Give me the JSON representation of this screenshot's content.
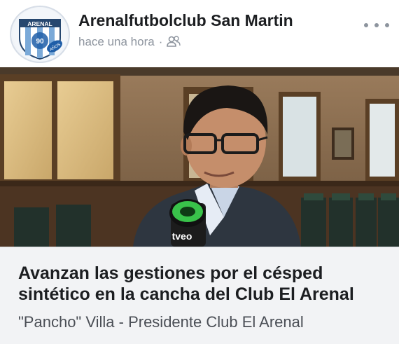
{
  "post": {
    "page_name": "Arenalfutbolclub San Martin",
    "timestamp": "hace una hora",
    "separator": "·",
    "audience_icon": "friends-audience-icon",
    "more_icon": "more-options-icon"
  },
  "avatar": {
    "logo_text": "ARENAL",
    "badge_text": "AÑOS",
    "icon": "club-crest-logo"
  },
  "photo": {
    "mic_brand": "tveo",
    "subject": "man in glasses being interviewed with microphone"
  },
  "link_preview": {
    "headline": "Avanzan las gestiones por el césped sintético en la cancha del Club El Arenal",
    "subline": "\"Pancho\" Villa - Presidente Club El Arenal"
  },
  "colors": {
    "page_bg": "#ffffff",
    "card_bg": "#f2f3f5",
    "text_primary": "#1c1e21",
    "text_secondary": "#8d949e",
    "crest_blue": "#7aa9d8",
    "mic_green": "#39c24a"
  }
}
